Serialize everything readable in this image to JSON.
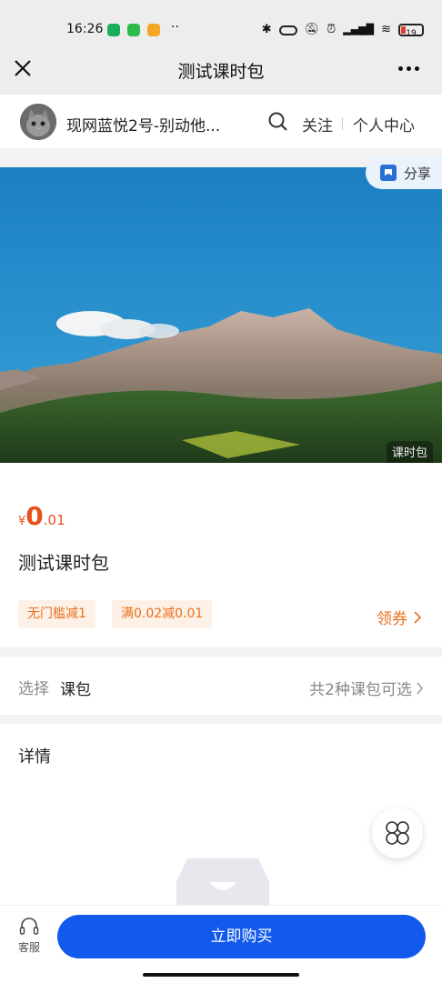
{
  "status_bar": {
    "time": "16:26",
    "battery": "19"
  },
  "nav": {
    "title": "测试课时包"
  },
  "store": {
    "name": "现网蓝悦2号-别动他...",
    "follow": "关注",
    "personal_center": "个人中心"
  },
  "banner": {
    "share": "分享",
    "tag": "课时包"
  },
  "product": {
    "currency": "¥",
    "price_int": "0",
    "price_dec": ".01",
    "name": "测试课时包",
    "tags": [
      "无门槛减1",
      "满0.02减0.01"
    ],
    "coupon": "领券"
  },
  "select_row": {
    "label": "选择",
    "value": "课包",
    "right": "共2种课包可选"
  },
  "detail": {
    "heading": "详情"
  },
  "bottom": {
    "service": "客服",
    "buy": "立即购买"
  },
  "colors": {
    "accent": "#1259ec",
    "price": "#e8501d",
    "tag_text": "#e8701d",
    "tag_bg": "#fdf0e6"
  }
}
